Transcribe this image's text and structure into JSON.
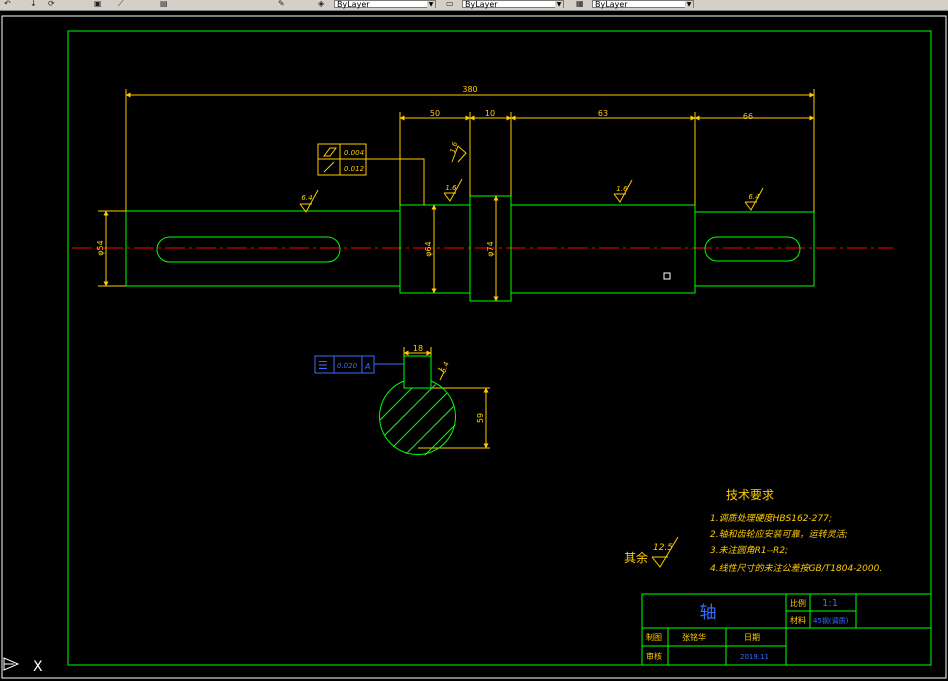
{
  "toolbar": {
    "icons": [
      "undo-icon",
      "redo-icon",
      "zoom-icon",
      "pan-icon",
      "match-properties-icon",
      "properties-icon",
      "paste-icon"
    ],
    "layer_combo": "ByLayer",
    "linetype_combo": "ByLayer",
    "lineweight_combo": "ByLayer"
  },
  "drawing": {
    "dims": {
      "total_length": "380",
      "d50": "50",
      "d10": "10",
      "d63": "63",
      "d66": "66",
      "dia54": "φ54",
      "dia64": "φ64",
      "dia74": "φ74",
      "keyway_width": "18",
      "keyway_depth": "59"
    },
    "roughness": {
      "left_seg": "6.4",
      "shoulder": "1.6",
      "collar_side": "1.6",
      "collar_top": "1.6",
      "middle_seg": "1.6",
      "right_seg": "6.4",
      "keyway": "6.4"
    },
    "gdt_frame": {
      "row1_value": "0.004",
      "row2_value": "0.012"
    },
    "symmetry_frame": {
      "symbol": "☰",
      "value": "0.020",
      "datum": "A"
    },
    "tech_requirements": {
      "title": "技术要求",
      "lines": [
        "1.调质处理硬度HBS162-277;",
        "2.轴和齿轮应安装可靠，运转灵活;",
        "3.未注圆角R1--R2;",
        "4.线性尺寸的未注公差按GB/T1804-2000."
      ]
    },
    "remainder": {
      "label": "其余",
      "value": "12.5"
    },
    "title_block": {
      "part_name": "轴",
      "scale_label": "比例",
      "scale_value": "1:1",
      "material_label": "材料",
      "material_value": "45钢(调质)",
      "drawn_label": "制图",
      "drawn_by": "张铭华",
      "date_label": "日期",
      "checked_label": "审核",
      "date_value": "2019.11"
    }
  },
  "ucs": {
    "x_label": "X"
  },
  "colors": {
    "background": "#000000",
    "frame": "#00ff00",
    "dimension": "#ffcc00",
    "outline": "#00ff00",
    "centerline": "#ff0000",
    "blue_text": "#3a6bff",
    "white": "#ffffff"
  }
}
